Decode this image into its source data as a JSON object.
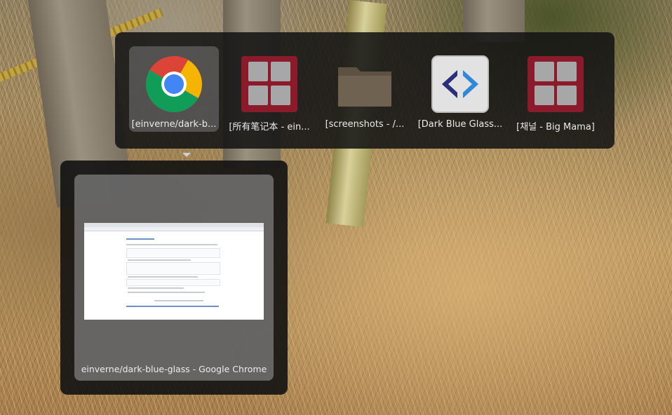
{
  "switcher": {
    "apps": [
      {
        "label": "[einverne/dark-b...",
        "icon": "chrome-icon",
        "selected": true
      },
      {
        "label": "[所有笔记本 - ein...",
        "icon": "grid-app-icon",
        "selected": false
      },
      {
        "label": "[screenshots - /...",
        "icon": "folder-icon",
        "selected": false
      },
      {
        "label": "[Dark Blue Glass...",
        "icon": "code-editor-icon",
        "selected": false
      },
      {
        "label": "[채널 - Big Mama]",
        "icon": "grid-app-icon",
        "selected": false
      }
    ]
  },
  "preview": {
    "window_title": "einverne/dark-blue-glass - Google Chrome"
  },
  "colors": {
    "switcher_bg": "#141414",
    "selected_bg": "#787878",
    "grid_icon_red": "#8b1a2a",
    "folder_brown": "#6f6250",
    "code_blue_dark": "#2a2f7a",
    "code_blue_light": "#2e8ad8"
  }
}
